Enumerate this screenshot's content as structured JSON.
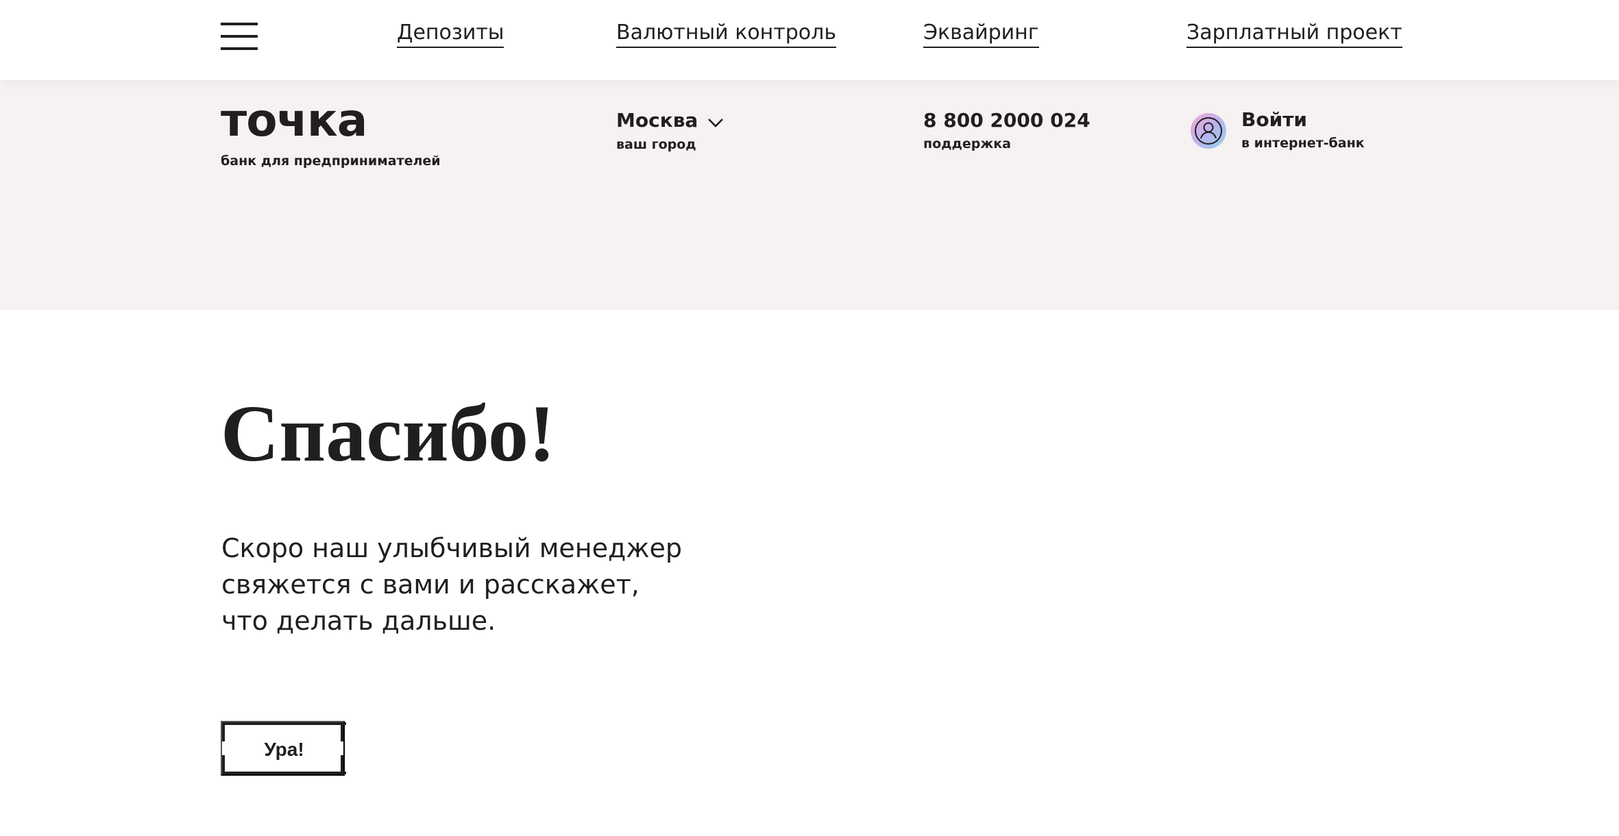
{
  "nav": {
    "menu_icon": "hamburger-menu-icon",
    "links": [
      {
        "label": "Депозиты"
      },
      {
        "label": "Валютный контроль"
      },
      {
        "label": "Эквайринг"
      },
      {
        "label": "Зарплатный проект"
      }
    ]
  },
  "header": {
    "logo": {
      "name": "точка",
      "tagline": "банк для предпринимателей"
    },
    "city": {
      "value": "Москва",
      "caption": "ваш город",
      "icon": "chevron-down-icon"
    },
    "phone": {
      "value": "8 800 2000 024",
      "caption": "поддержка"
    },
    "login": {
      "label": "Войти",
      "caption": "в интернет-банк",
      "icon": "user-avatar-icon"
    }
  },
  "main": {
    "headline": "Спасибо!",
    "message": "Скоро наш улыбчивый менеджер свяжется с вами и расскажет, что делать дальше.",
    "button_label": "Ура!"
  },
  "colors": {
    "text": "#211e1e",
    "band_background": "#f5f2f1",
    "page_background": "#ffffff"
  }
}
